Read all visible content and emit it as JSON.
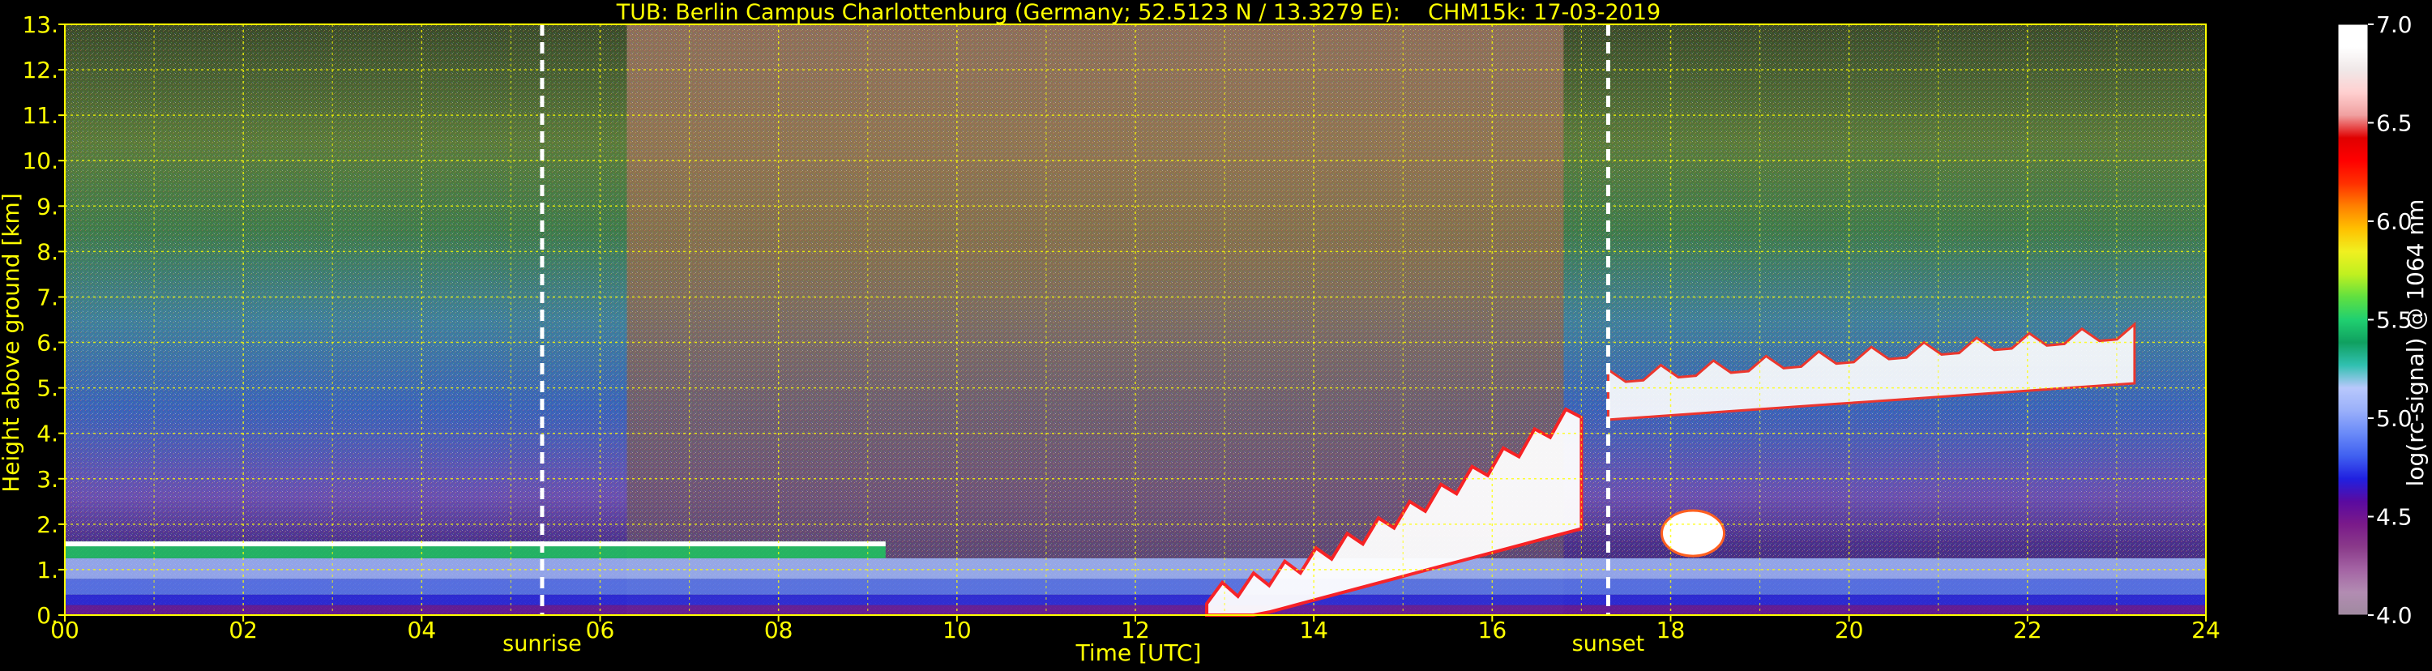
{
  "chart_data": {
    "type": "heatmap",
    "title": "TUB: Berlin Campus Charlottenburg (Germany; 52.5123 N / 13.3279 E):    CHM15k: 17-03-2019",
    "xlabel": "Time [UTC]",
    "ylabel": "Height above ground [km]",
    "xlim": [
      0,
      24
    ],
    "ylim": [
      0,
      13
    ],
    "x_ticks": [
      0,
      2,
      4,
      6,
      8,
      10,
      12,
      14,
      16,
      18,
      20,
      22,
      24
    ],
    "x_tick_labels": [
      "00",
      "02",
      "04",
      "06",
      "08",
      "10",
      "12",
      "14",
      "16",
      "18",
      "20",
      "22",
      "24"
    ],
    "y_ticks": [
      0,
      1,
      2,
      3,
      4,
      5,
      6,
      7,
      8,
      9,
      10,
      11,
      12,
      13
    ],
    "y_tick_labels": [
      "0.",
      "1.",
      "2.",
      "3.",
      "4.",
      "5.",
      "6.",
      "7.",
      "8.",
      "9.",
      "10.",
      "11.",
      "12.",
      "13."
    ],
    "grid": true,
    "grid_color": "#ffff00",
    "events": [
      {
        "label": "sunrise",
        "time": 5.35
      },
      {
        "label": "sunset",
        "time": 17.3
      }
    ],
    "colorbar": {
      "label": "log(rc-signal) @ 1064 nm",
      "range": [
        4.0,
        7.0
      ],
      "ticks": [
        4.0,
        4.5,
        5.0,
        5.5,
        6.0,
        6.5,
        7.0
      ],
      "tick_labels": [
        "4.0",
        "4.5",
        "5.0",
        "5.5",
        "6.0",
        "6.5",
        "7.0"
      ],
      "colors": [
        "#a08aa0",
        "#b28cb2",
        "#a464a4",
        "#8a3a8a",
        "#7a1a8a",
        "#5a0aa0",
        "#2020e0",
        "#4060f0",
        "#6a8af8",
        "#9ab0fa",
        "#b8c8fc",
        "#30c0b0",
        "#10a060",
        "#20d070",
        "#60e040",
        "#c0f020",
        "#f0f020",
        "#ffc000",
        "#ff8000",
        "#ff3000",
        "#ff0000",
        "#e00000",
        "#f0a0a0",
        "#ffd0d0",
        "#f0e8e8",
        "#ffffff",
        "#ffffff"
      ]
    },
    "features": [
      {
        "name": "night boundary layer top",
        "time_range": [
          0,
          9.2
        ],
        "height_km": 1.5
      },
      {
        "name": "clouds afternoon",
        "time_range": [
          12.8,
          17
        ],
        "height_km_range": [
          0,
          4.5
        ]
      },
      {
        "name": "evening cloud layer",
        "time_range": [
          17.3,
          23.2
        ],
        "height_km_range": [
          4.5,
          6.5
        ]
      },
      {
        "name": "small cloud",
        "time_range": [
          17.9,
          18.6
        ],
        "height_km_range": [
          1.3,
          2.3
        ]
      }
    ]
  }
}
